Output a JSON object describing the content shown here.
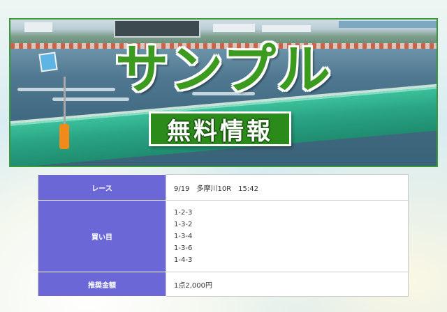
{
  "banner": {
    "headline": "サンプル",
    "subtitle": "無料情報"
  },
  "info_table": {
    "race_label": "レース",
    "race_value": "9/19　多摩川10R　15:42",
    "picks_label": "買い目",
    "picks": [
      "1-2-3",
      "1-3-2",
      "1-3-4",
      "1-3-6",
      "1-4-3"
    ],
    "amount_label": "推奨金額",
    "amount_value": "1点2,000円"
  },
  "colors": {
    "header_cell": "#6b67d6",
    "headline_green": "#3c9a1f",
    "amount_red": "#e0302a"
  }
}
